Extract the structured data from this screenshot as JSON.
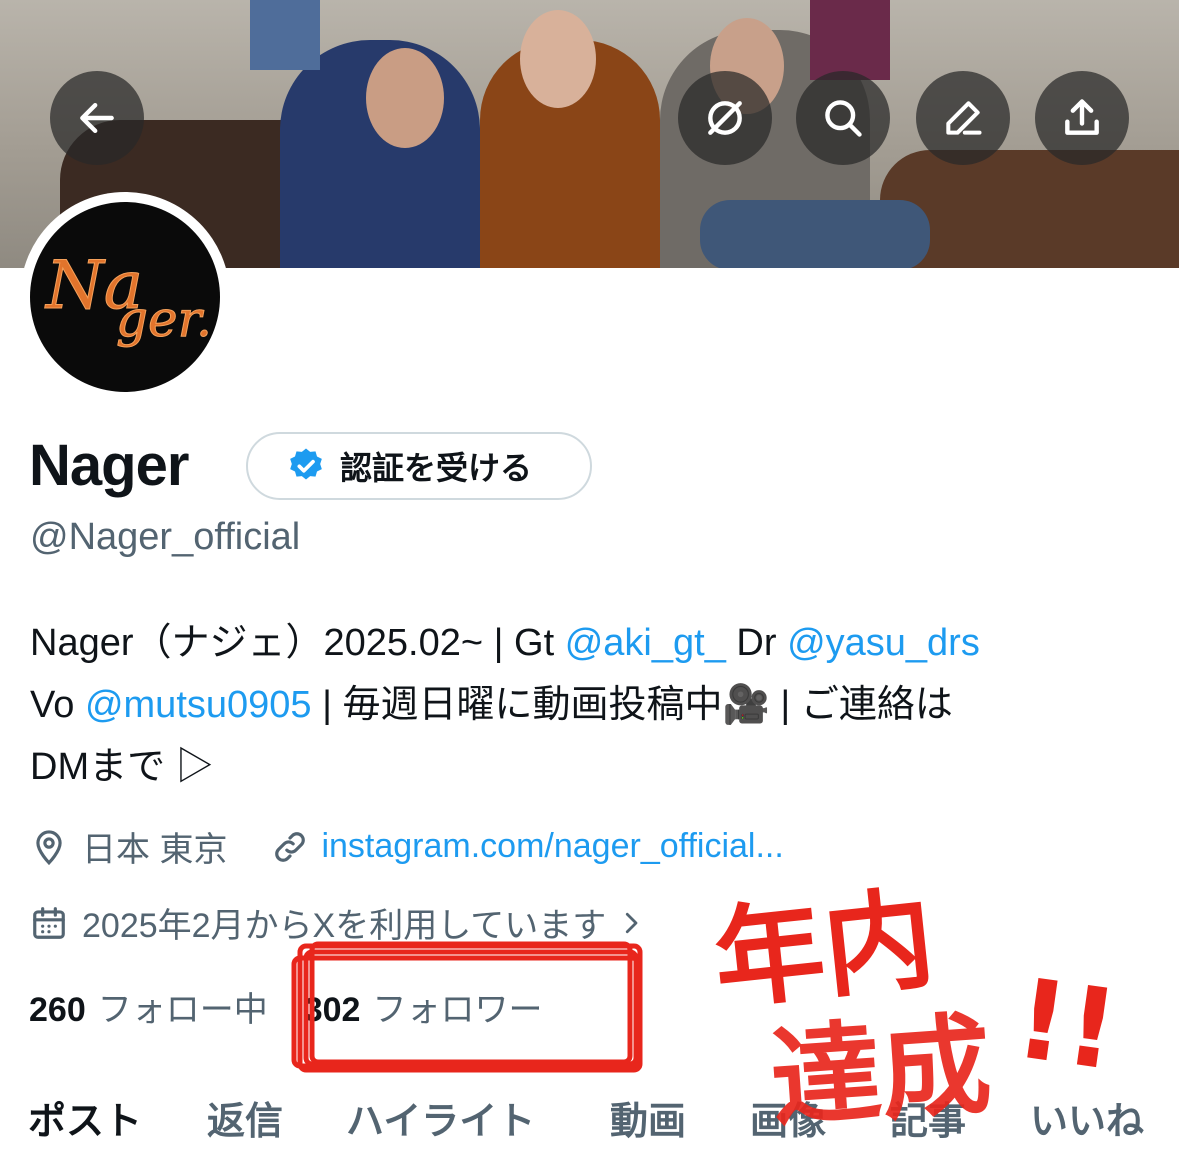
{
  "header": {
    "back_icon": "arrow-left-icon",
    "actions": [
      "grok-icon",
      "search-icon",
      "edit-icon",
      "share-icon"
    ]
  },
  "profile": {
    "avatar_logo": "Nager.",
    "name": "Nager",
    "verify_button": "認証を受ける",
    "handle": "@Nager_official",
    "bio": {
      "line1_a": "Nager（ナジェ）2025.02~ | Gt ",
      "mention_gt": "@aki_gt_",
      "line1_b": " Dr ",
      "mention_dr": "@yasu_drs",
      "line2_a": "Vo ",
      "mention_vo": "@mutsu0905",
      "line2_b": " | 毎週日曜に動画投稿中",
      "emoji": "🎥",
      "line2_c": " | ご連絡は",
      "line3": "DMまで ▷"
    },
    "location": "日本 東京",
    "website": "instagram.com/nager_official...",
    "joined": "2025年2月からXを利用しています",
    "following_count": "260",
    "following_label": "フォロー中",
    "followers_count": "302",
    "followers_label": "フォロワー"
  },
  "tabs": [
    "ポスト",
    "返信",
    "ハイライト",
    "動画",
    "画像",
    "記事",
    "いいね"
  ],
  "handwritten_annotation": "年内達成!!",
  "colors": {
    "accent": "#1d9bf0",
    "secondary_text": "#536471",
    "annotation_red": "#e8261c"
  }
}
